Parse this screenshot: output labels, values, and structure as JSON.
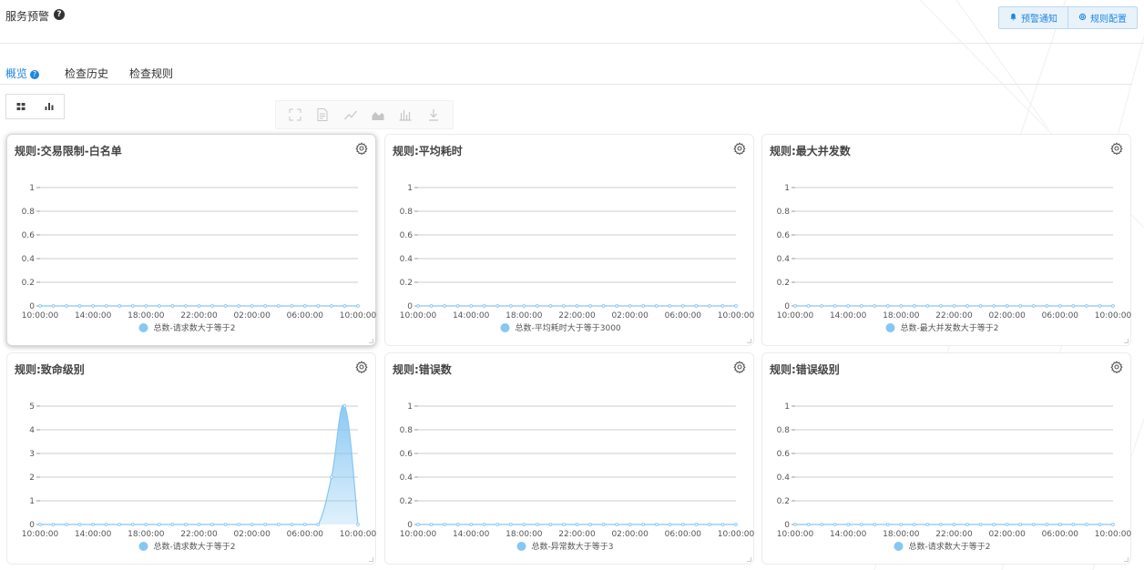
{
  "header": {
    "title": "服务预警",
    "help_icon": "question-circle-icon",
    "actions": [
      {
        "label": "预警通知",
        "icon": "bell-icon"
      },
      {
        "label": "规则配置",
        "icon": "gear-icon"
      }
    ]
  },
  "tabs": [
    {
      "label": "概览",
      "active": true,
      "has_help": true
    },
    {
      "label": "检查历史",
      "active": false
    },
    {
      "label": "检查规则",
      "active": false
    }
  ],
  "view_toggle": [
    {
      "icon": "grid-view-icon",
      "active": true
    },
    {
      "icon": "bar-chart-view-icon",
      "active": false
    }
  ],
  "chart_toolbar_icons": [
    "fullscreen-icon",
    "data-view-icon",
    "line-chart-icon",
    "area-chart-icon",
    "bar-chart-icon",
    "download-icon"
  ],
  "colors": {
    "accent": "#1e86e0",
    "series": "#86c7f3",
    "grid": "#cccccc"
  },
  "chart_data": [
    {
      "type": "area",
      "title": "规则:交易限制-白名单",
      "x": [
        "10:00:00",
        "14:00:00",
        "18:00:00",
        "22:00:00",
        "02:00:00",
        "06:00:00",
        "10:00:00"
      ],
      "ylim": [
        0,
        1
      ],
      "yticks": [
        "0",
        "0.2",
        "0.4",
        "0.6",
        "0.8",
        "1"
      ],
      "series": [
        {
          "name": "总数-请求数大于等于2",
          "values": [
            0,
            0,
            0,
            0,
            0,
            0,
            0,
            0,
            0,
            0,
            0,
            0,
            0,
            0,
            0,
            0,
            0,
            0,
            0,
            0,
            0,
            0,
            0,
            0,
            0
          ]
        }
      ],
      "grid": true,
      "legend": "bottom-center"
    },
    {
      "type": "area",
      "title": "规则:平均耗时",
      "x": [
        "10:00:00",
        "14:00:00",
        "18:00:00",
        "22:00:00",
        "02:00:00",
        "06:00:00",
        "10:00:00"
      ],
      "ylim": [
        0,
        1
      ],
      "yticks": [
        "0",
        "0.2",
        "0.4",
        "0.6",
        "0.8",
        "1"
      ],
      "series": [
        {
          "name": "总数-平均耗时大于等于3000",
          "values": [
            0,
            0,
            0,
            0,
            0,
            0,
            0,
            0,
            0,
            0,
            0,
            0,
            0,
            0,
            0,
            0,
            0,
            0,
            0,
            0,
            0,
            0,
            0,
            0,
            0
          ]
        }
      ],
      "grid": true,
      "legend": "bottom-center"
    },
    {
      "type": "area",
      "title": "规则:最大并发数",
      "x": [
        "10:00:00",
        "14:00:00",
        "18:00:00",
        "22:00:00",
        "02:00:00",
        "06:00:00",
        "10:00:00"
      ],
      "ylim": [
        0,
        1
      ],
      "yticks": [
        "0",
        "0.2",
        "0.4",
        "0.6",
        "0.8",
        "1"
      ],
      "series": [
        {
          "name": "总数-最大并发数大于等于2",
          "values": [
            0,
            0,
            0,
            0,
            0,
            0,
            0,
            0,
            0,
            0,
            0,
            0,
            0,
            0,
            0,
            0,
            0,
            0,
            0,
            0,
            0,
            0,
            0,
            0,
            0
          ]
        }
      ],
      "grid": true,
      "legend": "bottom-center"
    },
    {
      "type": "area",
      "title": "规则:致命级别",
      "x": [
        "10:00:00",
        "14:00:00",
        "18:00:00",
        "22:00:00",
        "02:00:00",
        "06:00:00",
        "10:00:00"
      ],
      "ylim": [
        0,
        5
      ],
      "yticks": [
        "0",
        "1",
        "2",
        "3",
        "4",
        "5"
      ],
      "series": [
        {
          "name": "总数-请求数大于等于2",
          "values": [
            0,
            0,
            0,
            0,
            0,
            0,
            0,
            0,
            0,
            0,
            0,
            0,
            0,
            0,
            0,
            0,
            0,
            0,
            0,
            0,
            0,
            0,
            2,
            5,
            0
          ]
        }
      ],
      "grid": true,
      "legend": "bottom-center"
    },
    {
      "type": "area",
      "title": "规则:错误数",
      "x": [
        "10:00:00",
        "14:00:00",
        "18:00:00",
        "22:00:00",
        "02:00:00",
        "06:00:00",
        "10:00:00"
      ],
      "ylim": [
        0,
        1
      ],
      "yticks": [
        "0",
        "0.2",
        "0.4",
        "0.6",
        "0.8",
        "1"
      ],
      "series": [
        {
          "name": "总数-异常数大于等于3",
          "values": [
            0,
            0,
            0,
            0,
            0,
            0,
            0,
            0,
            0,
            0,
            0,
            0,
            0,
            0,
            0,
            0,
            0,
            0,
            0,
            0,
            0,
            0,
            0,
            0,
            0
          ]
        }
      ],
      "grid": true,
      "legend": "bottom-center"
    },
    {
      "type": "area",
      "title": "规则:错误级别",
      "x": [
        "10:00:00",
        "14:00:00",
        "18:00:00",
        "22:00:00",
        "02:00:00",
        "06:00:00",
        "10:00:00"
      ],
      "ylim": [
        0,
        1
      ],
      "yticks": [
        "0",
        "0.2",
        "0.4",
        "0.6",
        "0.8",
        "1"
      ],
      "series": [
        {
          "name": "总数-请求数大于等于2",
          "values": [
            0,
            0,
            0,
            0,
            0,
            0,
            0,
            0,
            0,
            0,
            0,
            0,
            0,
            0,
            0,
            0,
            0,
            0,
            0,
            0,
            0,
            0,
            0,
            0,
            0
          ]
        }
      ],
      "grid": true,
      "legend": "bottom-center"
    }
  ]
}
